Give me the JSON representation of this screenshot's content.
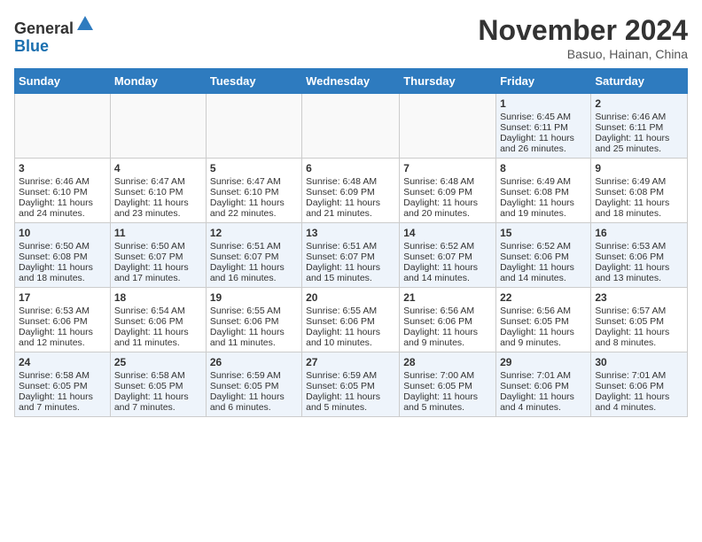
{
  "header": {
    "logo_line1": "General",
    "logo_line2": "Blue",
    "month_title": "November 2024",
    "location": "Basuo, Hainan, China"
  },
  "days_of_week": [
    "Sunday",
    "Monday",
    "Tuesday",
    "Wednesday",
    "Thursday",
    "Friday",
    "Saturday"
  ],
  "weeks": [
    [
      {
        "day": "",
        "info": ""
      },
      {
        "day": "",
        "info": ""
      },
      {
        "day": "",
        "info": ""
      },
      {
        "day": "",
        "info": ""
      },
      {
        "day": "",
        "info": ""
      },
      {
        "day": "1",
        "info": "Sunrise: 6:45 AM\nSunset: 6:11 PM\nDaylight: 11 hours and 26 minutes."
      },
      {
        "day": "2",
        "info": "Sunrise: 6:46 AM\nSunset: 6:11 PM\nDaylight: 11 hours and 25 minutes."
      }
    ],
    [
      {
        "day": "3",
        "info": "Sunrise: 6:46 AM\nSunset: 6:10 PM\nDaylight: 11 hours and 24 minutes."
      },
      {
        "day": "4",
        "info": "Sunrise: 6:47 AM\nSunset: 6:10 PM\nDaylight: 11 hours and 23 minutes."
      },
      {
        "day": "5",
        "info": "Sunrise: 6:47 AM\nSunset: 6:10 PM\nDaylight: 11 hours and 22 minutes."
      },
      {
        "day": "6",
        "info": "Sunrise: 6:48 AM\nSunset: 6:09 PM\nDaylight: 11 hours and 21 minutes."
      },
      {
        "day": "7",
        "info": "Sunrise: 6:48 AM\nSunset: 6:09 PM\nDaylight: 11 hours and 20 minutes."
      },
      {
        "day": "8",
        "info": "Sunrise: 6:49 AM\nSunset: 6:08 PM\nDaylight: 11 hours and 19 minutes."
      },
      {
        "day": "9",
        "info": "Sunrise: 6:49 AM\nSunset: 6:08 PM\nDaylight: 11 hours and 18 minutes."
      }
    ],
    [
      {
        "day": "10",
        "info": "Sunrise: 6:50 AM\nSunset: 6:08 PM\nDaylight: 11 hours and 18 minutes."
      },
      {
        "day": "11",
        "info": "Sunrise: 6:50 AM\nSunset: 6:07 PM\nDaylight: 11 hours and 17 minutes."
      },
      {
        "day": "12",
        "info": "Sunrise: 6:51 AM\nSunset: 6:07 PM\nDaylight: 11 hours and 16 minutes."
      },
      {
        "day": "13",
        "info": "Sunrise: 6:51 AM\nSunset: 6:07 PM\nDaylight: 11 hours and 15 minutes."
      },
      {
        "day": "14",
        "info": "Sunrise: 6:52 AM\nSunset: 6:07 PM\nDaylight: 11 hours and 14 minutes."
      },
      {
        "day": "15",
        "info": "Sunrise: 6:52 AM\nSunset: 6:06 PM\nDaylight: 11 hours and 14 minutes."
      },
      {
        "day": "16",
        "info": "Sunrise: 6:53 AM\nSunset: 6:06 PM\nDaylight: 11 hours and 13 minutes."
      }
    ],
    [
      {
        "day": "17",
        "info": "Sunrise: 6:53 AM\nSunset: 6:06 PM\nDaylight: 11 hours and 12 minutes."
      },
      {
        "day": "18",
        "info": "Sunrise: 6:54 AM\nSunset: 6:06 PM\nDaylight: 11 hours and 11 minutes."
      },
      {
        "day": "19",
        "info": "Sunrise: 6:55 AM\nSunset: 6:06 PM\nDaylight: 11 hours and 11 minutes."
      },
      {
        "day": "20",
        "info": "Sunrise: 6:55 AM\nSunset: 6:06 PM\nDaylight: 11 hours and 10 minutes."
      },
      {
        "day": "21",
        "info": "Sunrise: 6:56 AM\nSunset: 6:06 PM\nDaylight: 11 hours and 9 minutes."
      },
      {
        "day": "22",
        "info": "Sunrise: 6:56 AM\nSunset: 6:05 PM\nDaylight: 11 hours and 9 minutes."
      },
      {
        "day": "23",
        "info": "Sunrise: 6:57 AM\nSunset: 6:05 PM\nDaylight: 11 hours and 8 minutes."
      }
    ],
    [
      {
        "day": "24",
        "info": "Sunrise: 6:58 AM\nSunset: 6:05 PM\nDaylight: 11 hours and 7 minutes."
      },
      {
        "day": "25",
        "info": "Sunrise: 6:58 AM\nSunset: 6:05 PM\nDaylight: 11 hours and 7 minutes."
      },
      {
        "day": "26",
        "info": "Sunrise: 6:59 AM\nSunset: 6:05 PM\nDaylight: 11 hours and 6 minutes."
      },
      {
        "day": "27",
        "info": "Sunrise: 6:59 AM\nSunset: 6:05 PM\nDaylight: 11 hours and 5 minutes."
      },
      {
        "day": "28",
        "info": "Sunrise: 7:00 AM\nSunset: 6:05 PM\nDaylight: 11 hours and 5 minutes."
      },
      {
        "day": "29",
        "info": "Sunrise: 7:01 AM\nSunset: 6:06 PM\nDaylight: 11 hours and 4 minutes."
      },
      {
        "day": "30",
        "info": "Sunrise: 7:01 AM\nSunset: 6:06 PM\nDaylight: 11 hours and 4 minutes."
      }
    ]
  ]
}
